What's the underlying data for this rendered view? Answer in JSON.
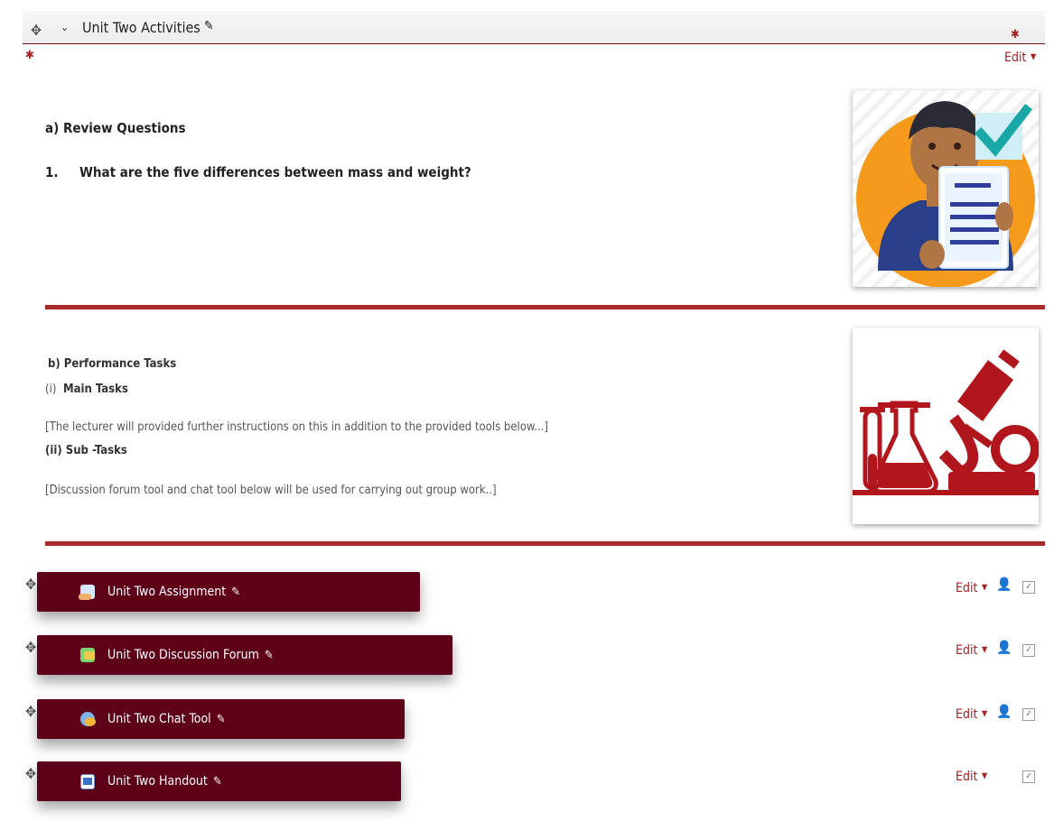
{
  "section": {
    "title": "Unit Two Activities",
    "edit_label": "Edit"
  },
  "content": {
    "review_heading": "a)  Review Questions",
    "question_number": "1.",
    "question_text": "What are the five differences between mass and weight?",
    "performance_heading": "b) Performance Tasks",
    "main_tasks_prefix": "(i)",
    "main_tasks_label": "Main Tasks",
    "main_tasks_note": "[The lecturer will provided further instructions on this in addition to the provided tools below...]",
    "sub_tasks_label": "(ii) Sub -Tasks",
    "sub_tasks_note": "[Discussion forum tool and chat tool below will be used for carrying out group work..]"
  },
  "activities": [
    {
      "name": "Unit Two Assignment",
      "icon": "assignment-icon",
      "edit": "Edit"
    },
    {
      "name": "Unit Two Discussion Forum",
      "icon": "forum-icon",
      "edit": "Edit"
    },
    {
      "name": "Unit Two Chat Tool",
      "icon": "chat-icon",
      "edit": "Edit"
    },
    {
      "name": "Unit Two Handout",
      "icon": "document-icon",
      "edit": "Edit"
    }
  ],
  "colors": {
    "accent": "#a52222",
    "activity_bg": "#5e0018",
    "divider": "#a82a2a",
    "orange": "#f59a1b"
  }
}
